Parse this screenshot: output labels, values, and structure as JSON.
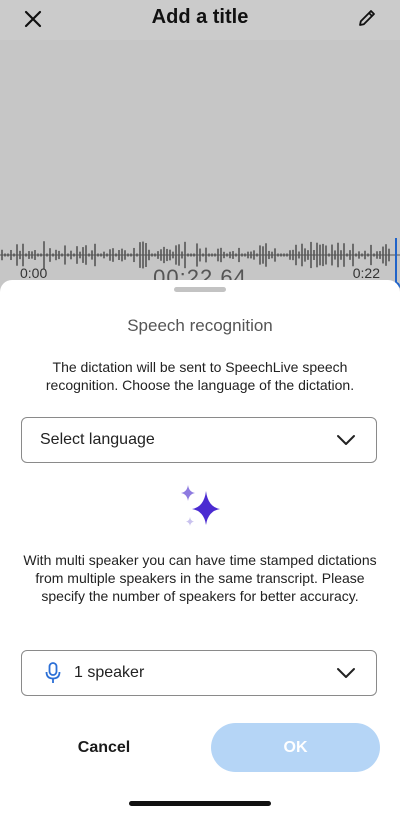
{
  "header": {
    "title": "Add a title",
    "close_icon": "close-icon",
    "edit_icon": "pencil-icon"
  },
  "recorder": {
    "time_start": "0:00",
    "time_current": "00:22.64",
    "time_end": "0:22"
  },
  "sheet": {
    "title": "Speech recognition",
    "description": "The dictation will be sent to SpeechLive speech recognition. Choose the language of the dictation.",
    "language_select": {
      "value": "Select language"
    },
    "multi_speaker_description": "With multi speaker you can have time stamped dictations from multiple speakers in the same transcript. Please specify the number of speakers for better accuracy.",
    "speaker_select": {
      "value": "1 speaker",
      "icon": "microphone-icon"
    },
    "cancel_label": "Cancel",
    "ok_label": "OK"
  },
  "colors": {
    "accent": "#4b2bd1",
    "ok_disabled": "#b5d5f6",
    "mic_blue": "#2b6fd6"
  }
}
